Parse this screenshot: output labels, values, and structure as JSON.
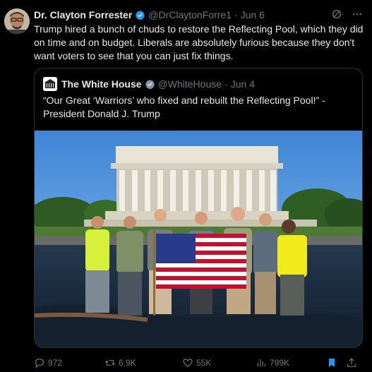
{
  "tweet": {
    "author_name": "Dr. Clayton Forrester",
    "handle": "@DrClaytonForre1",
    "separator": "·",
    "date": "Jun 6",
    "text": "Trump hired a bunch of chuds to restore the Reflecting Pool, which they did on time and on budget. Liberals are absolutely furious because they don't want voters to see that you can just fix things."
  },
  "quote": {
    "author_name": "The White House",
    "handle": "@WhiteHouse",
    "separator": "·",
    "date": "Jun 4",
    "text": "“Our Great ‘Warriors’ who fixed and rebuilt the Reflecting Pool!” - President Donald J. Trump"
  },
  "actions": {
    "replies": "972",
    "reposts": "6.9K",
    "likes": "55K",
    "views": "799K"
  },
  "colors": {
    "background": "#000000",
    "text": "#e7e9ea",
    "muted": "#71767b",
    "verified": "#1d9bf0",
    "border": "#2f3336"
  },
  "icons": [
    "grok-icon",
    "more-icon",
    "verified-icon",
    "reply-icon",
    "repost-icon",
    "like-icon",
    "views-icon",
    "bookmark-icon",
    "share-icon"
  ]
}
